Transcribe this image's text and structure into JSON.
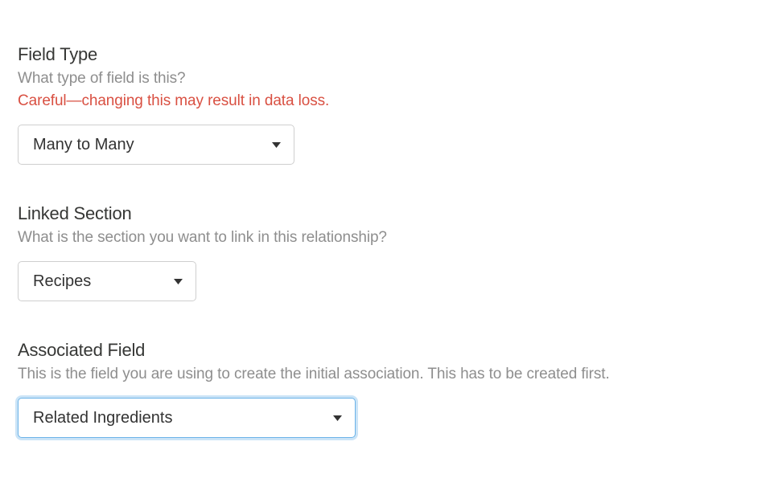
{
  "fieldType": {
    "heading": "Field Type",
    "description": "What type of field is this?",
    "warning": "Careful—changing this may result in data loss.",
    "selected": "Many to Many"
  },
  "linkedSection": {
    "heading": "Linked Section",
    "description": "What is the section you want to link in this relationship?",
    "selected": "Recipes"
  },
  "associatedField": {
    "heading": "Associated Field",
    "description": "This is the field you are using to create the initial association. This has to be created first.",
    "selected": "Related Ingredients"
  }
}
